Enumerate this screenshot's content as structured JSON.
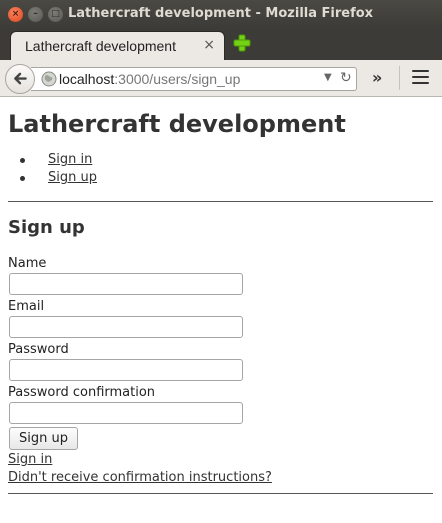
{
  "window": {
    "title": "Lathercraft development - Mozilla Firefox",
    "close_glyph": "×",
    "minimize_glyph": "–",
    "maximize_glyph": "□"
  },
  "tabs": [
    {
      "label": "Lathercraft development",
      "close_glyph": "×",
      "active": true
    }
  ],
  "navbar": {
    "url_host": "localhost",
    "url_path": ":3000/users/sign_up",
    "overflow_glyph": "»",
    "reload_glyph": "↻",
    "dropdown_glyph": "▼",
    "icons": [
      "back-arrow-icon",
      "globe-icon",
      "dropdown-arrow-icon",
      "reload-icon",
      "overflow-chevron-icon",
      "hamburger-menu-icon",
      "new-tab-plus-icon"
    ]
  },
  "page": {
    "site_title": "Lathercraft development",
    "nav_links": [
      "Sign in",
      "Sign up"
    ],
    "form": {
      "title": "Sign up",
      "fields": [
        {
          "label": "Name",
          "value": "",
          "type": "text"
        },
        {
          "label": "Email",
          "value": "",
          "type": "email"
        },
        {
          "label": "Password",
          "value": "",
          "type": "password"
        },
        {
          "label": "Password confirmation",
          "value": "",
          "type": "password"
        }
      ],
      "submit_label": "Sign up"
    },
    "links": {
      "sign_in": "Sign in",
      "resend_confirmation": "Didn't receive confirmation instructions?"
    }
  },
  "colors": {
    "titlebar_bg": "#3c3b37",
    "tab_bg": "#ece9e4",
    "close_button": "#e0451c",
    "new_tab_plus": "#4e9a06",
    "text": "#333333"
  }
}
